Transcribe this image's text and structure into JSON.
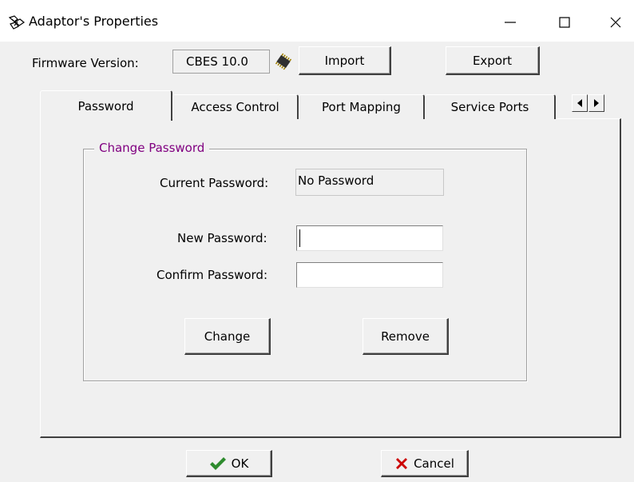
{
  "window": {
    "title": "Adaptor's Properties"
  },
  "firmware": {
    "label": "Firmware Version:",
    "value": "CBES 10.0"
  },
  "toolbar": {
    "import_label": "Import",
    "export_label": "Export"
  },
  "tabs": [
    {
      "label": "Password",
      "active": true
    },
    {
      "label": "Access Control",
      "active": false
    },
    {
      "label": "Port Mapping",
      "active": false
    },
    {
      "label": "Service Ports",
      "active": false
    }
  ],
  "password_group": {
    "legend": "Change Password",
    "legend_color": "#800080",
    "current_label": "Current Password:",
    "current_value": "No Password",
    "new_label": "New Password:",
    "new_value": "",
    "confirm_label": "Confirm Password:",
    "confirm_value": "",
    "change_label": "Change",
    "remove_label": "Remove"
  },
  "footer": {
    "ok_label": "OK",
    "cancel_label": "Cancel"
  },
  "icons": {
    "app": "network-adaptor-icon",
    "firmware": "chip-icon",
    "ok": "checkmark-icon",
    "cancel": "x-mark-icon",
    "ok_color": "#2e8b2e",
    "cancel_color": "#cc0000"
  }
}
